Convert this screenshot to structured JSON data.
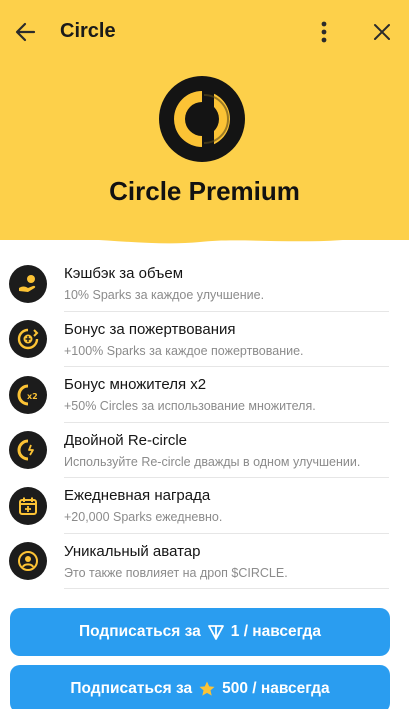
{
  "topbar": {
    "title": "Circle"
  },
  "hero": {
    "title": "Circle Premium"
  },
  "colors": {
    "header_bg": "#fdd04a",
    "accent_yellow": "#fcc335",
    "icon_bg": "#1c1c1c",
    "button_blue": "#2a9df0"
  },
  "features": [
    {
      "title": "Кэшбэк за объем",
      "desc": "10% Sparks за каждое улучшение.",
      "icon": "cashback-hand-icon"
    },
    {
      "title": "Бонус за пожертвования",
      "desc": "+100% Sparks за каждое пожертвование.",
      "icon": "donation-bonus-icon"
    },
    {
      "title": "Бонус множителя x2",
      "desc": "+50% Circles за использование множителя.",
      "icon": "multiplier-x2-icon"
    },
    {
      "title": "Двойной Re-circle",
      "desc": "Используйте Re-circle дважды в одном улучшении.",
      "icon": "double-recircle-icon"
    },
    {
      "title": "Ежедневная награда",
      "desc": "+20,000 Sparks ежедневно.",
      "icon": "daily-reward-calendar-icon"
    },
    {
      "title": "Уникальный аватар",
      "desc": "Это также повлияет на дроп $CIRCLE.",
      "icon": "unique-avatar-icon"
    }
  ],
  "buttons": {
    "ton": {
      "prefix": "Подписаться за",
      "amount": "1 / навсегда",
      "icon": "ton-icon"
    },
    "stars": {
      "prefix": "Подписаться за",
      "amount": "500 / навсегда",
      "icon": "star-icon"
    }
  }
}
